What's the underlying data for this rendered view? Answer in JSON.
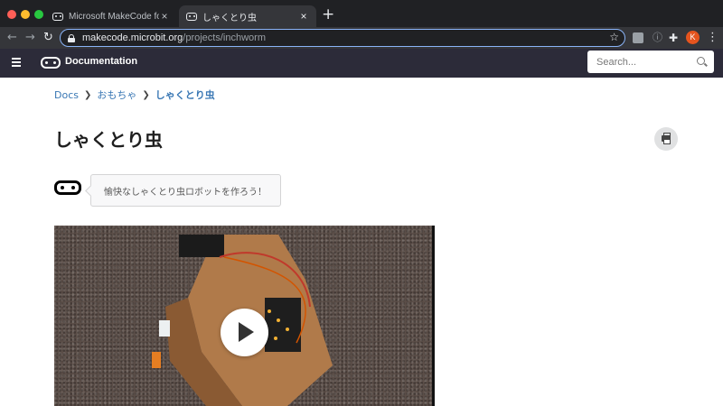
{
  "browser": {
    "tabs": [
      {
        "title": "Microsoft MakeCode for micro:bit",
        "active": false
      },
      {
        "title": "しゃくとり虫",
        "active": true
      }
    ],
    "new_tab_glyph": "+",
    "url_host": "makecode.microbit.org",
    "url_path": "/projects/inchworm",
    "profile_initial": "K"
  },
  "header": {
    "title": "Documentation",
    "search_placeholder": "Search..."
  },
  "breadcrumb": [
    {
      "label": "Docs"
    },
    {
      "label": "おもちゃ"
    },
    {
      "label": "しゃくとり虫"
    }
  ],
  "page": {
    "title": "しゃくとり虫",
    "description": "愉快なしゃくとり虫ロボットを作ろう！"
  },
  "colors": {
    "header_bg": "#2c2b39",
    "link": "#3977b4",
    "chrome_dark": "#202124",
    "chrome_toolbar": "#35363a"
  },
  "icons": [
    "close-icon",
    "lock-icon",
    "star-icon",
    "menu-icon",
    "microbit-logo-icon",
    "search-icon",
    "print-icon",
    "play-icon",
    "chevron-right-icon"
  ]
}
